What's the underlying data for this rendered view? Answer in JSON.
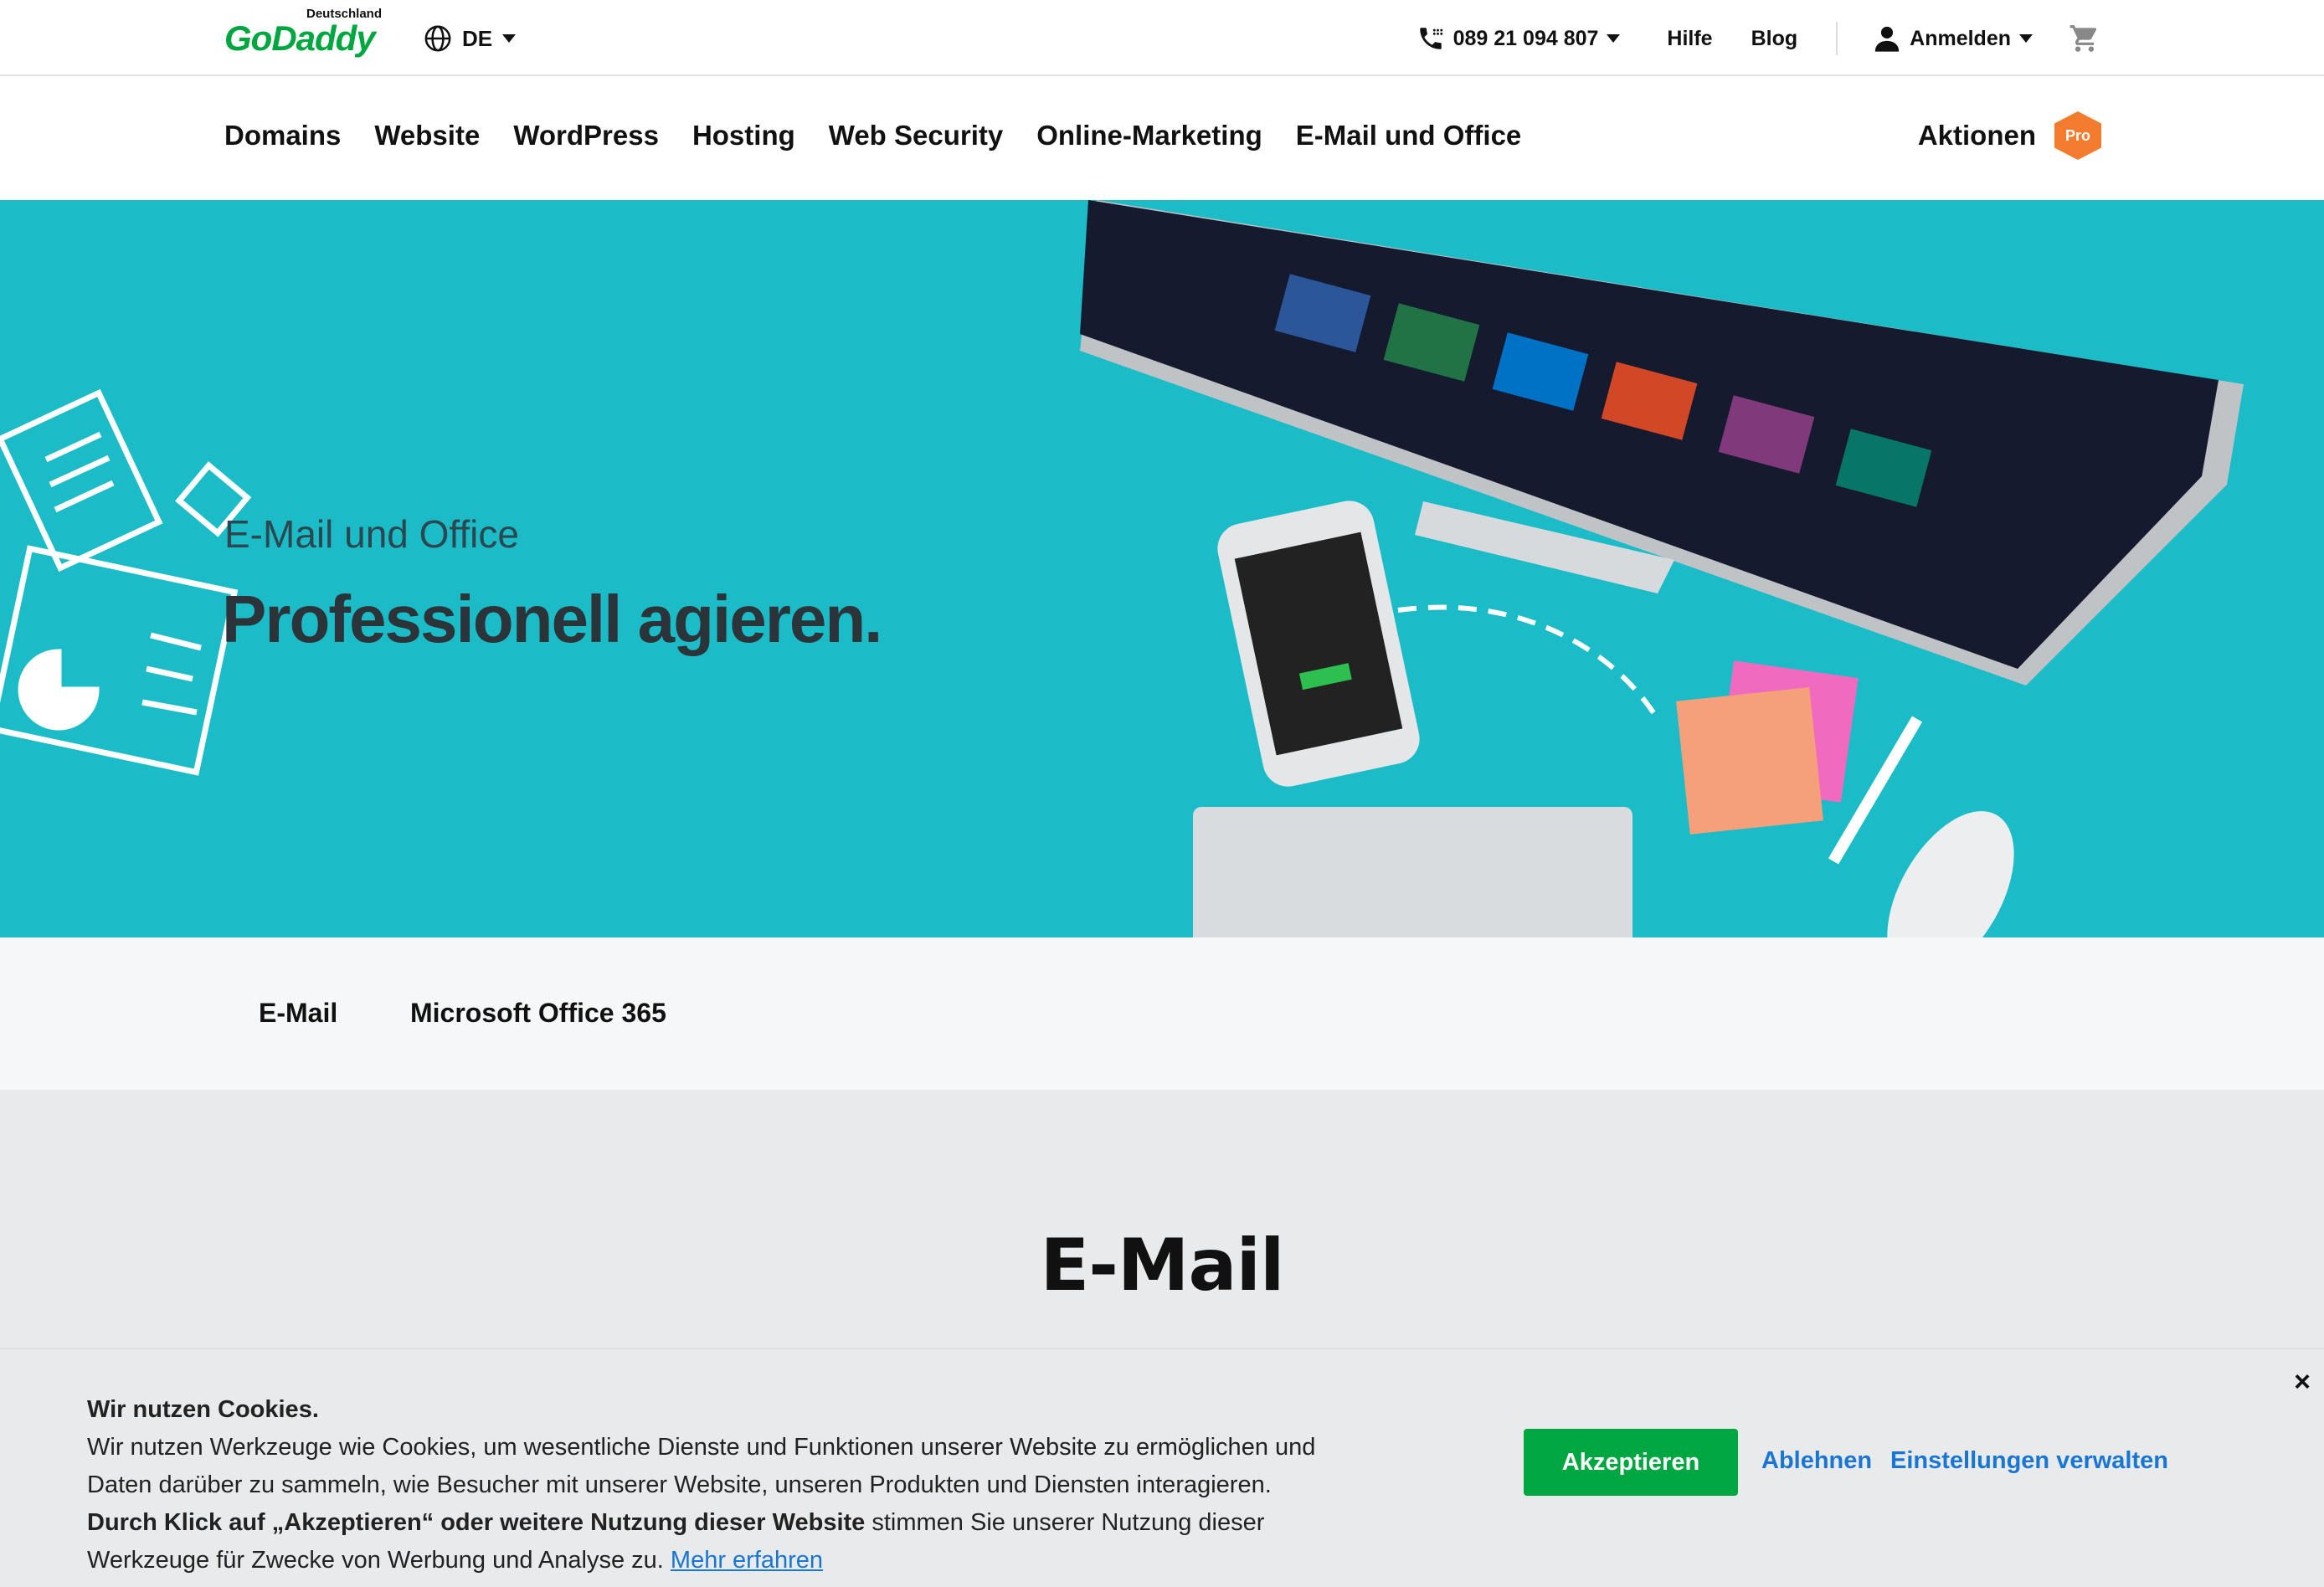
{
  "topbar": {
    "logo_country": "Deutschland",
    "logo_brand": "GoDaddy",
    "language": "DE",
    "phone": "089 21 094 807",
    "help": "Hilfe",
    "blog": "Blog",
    "signin": "Anmelden"
  },
  "nav": {
    "items": [
      "Domains",
      "Website",
      "WordPress",
      "Hosting",
      "Web Security",
      "Online-Marketing",
      "E-Mail und Office"
    ],
    "promo": "Aktionen",
    "promo_badge": "Pro"
  },
  "hero": {
    "eyebrow": "E-Mail und Office",
    "headline": "Professionell agieren."
  },
  "tabs": [
    "E-Mail",
    "Microsoft Office 365"
  ],
  "section": {
    "title": "E-Mail"
  },
  "cookie": {
    "title": "Wir nutzen Cookies.",
    "body_1": "Wir nutzen Werkzeuge wie Cookies, um wesentliche Dienste und Funktionen unserer Website zu ermöglichen und Daten darüber zu sammeln, wie Besucher mit unserer Website, unseren Produkten und Diensten interagieren.",
    "body_bold": "Durch Klick auf „Akzeptieren“ oder weitere Nutzung dieser Website",
    "body_2": " stimmen Sie unserer Nutzung dieser Werkzeuge für Zwecke von Werbung und Analyse zu. ",
    "learn_more": "Mehr erfahren",
    "accept": "Akzeptieren",
    "decline": "Ablehnen",
    "manage": "Einstellungen verwalten",
    "close": "×"
  },
  "colors": {
    "brand_green": "#00a63f",
    "hero_bg": "#1bbcc8",
    "promo_orange": "#f27b2d",
    "link_blue": "#1976d2"
  }
}
